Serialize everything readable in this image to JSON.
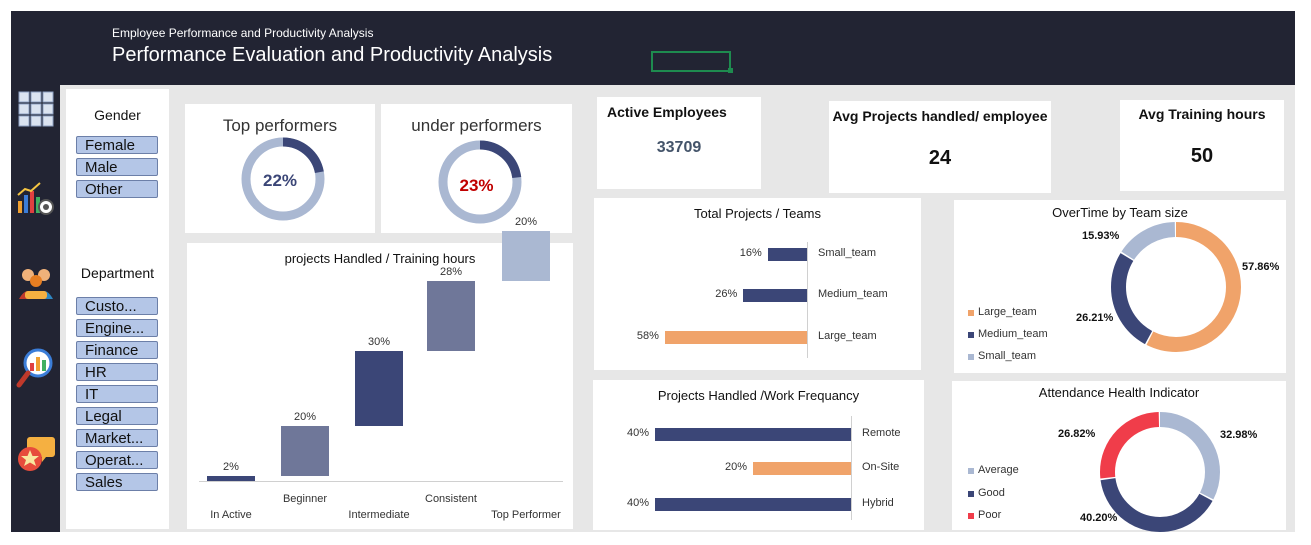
{
  "header": {
    "subtitle": "Employee Performance and Productivity Analysis",
    "title": "Performance Evaluation  and Productivity Analysis"
  },
  "nav_icons": [
    "grid-icon",
    "bar-chart-settings-icon",
    "team-icon",
    "magnifier-chart-icon",
    "chat-star-icon"
  ],
  "filters": {
    "gender_label": "Gender",
    "gender": [
      "Female",
      "Male",
      "Other"
    ],
    "department_label": "Department",
    "department": [
      "Custo...",
      "Engine...",
      "Finance",
      "HR",
      "IT",
      "Legal",
      "Market...",
      "Operat...",
      "Sales"
    ]
  },
  "kpis": {
    "top_performers": {
      "label": "Top performers",
      "value": "22%",
      "fraction": 0.22
    },
    "under_performers": {
      "label": "under performers",
      "value": "23%",
      "fraction": 0.23
    },
    "active_employees": {
      "label": "Active Employees",
      "value": "33709"
    },
    "avg_projects": {
      "label": "Avg Projects handled/ employee",
      "value": "24"
    },
    "avg_training": {
      "label": "Avg Training hours",
      "value": "50"
    }
  },
  "colors": {
    "dark_navy": "#222433",
    "series_blue": "#3b4677",
    "orange": "#f0a36a",
    "light_blue": "#aab8d2",
    "red": "#f03d4a",
    "chip": "#b4c6e7",
    "under_value": "#c00000"
  },
  "chart_data": [
    {
      "type": "bar",
      "title": "projects Handled / Training hours",
      "categories": [
        "In Active",
        "Beginner",
        "Intermediate",
        "Consistent",
        "Top Performer"
      ],
      "values": [
        2,
        20,
        30,
        28,
        20
      ],
      "data_labels": [
        "2%",
        "20%",
        "30%",
        "28%",
        "20%"
      ]
    },
    {
      "type": "bar",
      "title": "Total Projects / Teams",
      "categories": [
        "Small_team",
        "Medium_team",
        "Large_team"
      ],
      "values": [
        16,
        26,
        58
      ],
      "data_labels": [
        "16%",
        "26%",
        "58%"
      ]
    },
    {
      "type": "pie",
      "title": "OverTime by Team size",
      "categories": [
        "Large_team",
        "Medium_team",
        "Small_team"
      ],
      "values": [
        57.86,
        26.21,
        15.93
      ],
      "data_labels": [
        "57.86%",
        "26.21%",
        "15.93%"
      ]
    },
    {
      "type": "bar",
      "title": "Projects Handled /Work Frequancy",
      "categories": [
        "Remote",
        "On-Site",
        "Hybrid"
      ],
      "values": [
        40,
        20,
        40
      ],
      "data_labels": [
        "40%",
        "20%",
        "40%"
      ]
    },
    {
      "type": "pie",
      "title": "Attendance Health Indicator",
      "categories": [
        "Average",
        "Good",
        "Poor"
      ],
      "values": [
        32.98,
        40.2,
        26.82
      ],
      "data_labels": [
        "32.98%",
        "40.20%",
        "26.82%"
      ]
    }
  ]
}
